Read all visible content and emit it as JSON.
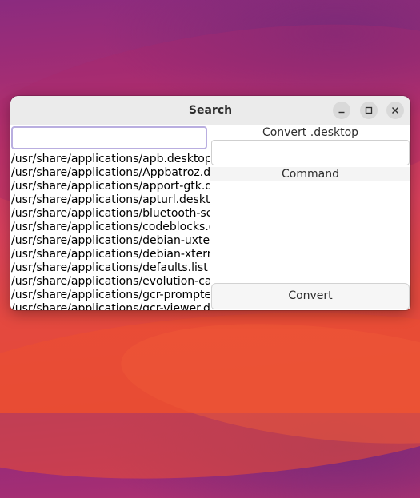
{
  "window": {
    "title": "Search"
  },
  "search": {
    "value": ""
  },
  "files": [
    "/usr/share/applications/apb.desktop",
    "/usr/share/applications/Appbatroz.desktop",
    "/usr/share/applications/apport-gtk.desktop",
    "/usr/share/applications/apturl.desktop",
    "/usr/share/applications/bluetooth-sendto.desktop",
    "/usr/share/applications/codeblocks.desktop",
    "/usr/share/applications/debian-uxterm.desktop",
    "/usr/share/applications/debian-xterm.desktop",
    "/usr/share/applications/defaults.list",
    "/usr/share/applications/evolution-calendar.desktop",
    "/usr/share/applications/gcr-prompter.desktop",
    "/usr/share/applications/gcr-viewer.desktop"
  ],
  "converter": {
    "section_label": "Convert .desktop",
    "desktop_value": "",
    "command_label": "Command",
    "command_value": "",
    "convert_label": "Convert"
  },
  "icons": {
    "minimize": "minimize-icon",
    "maximize": "maximize-icon",
    "close": "close-icon"
  }
}
